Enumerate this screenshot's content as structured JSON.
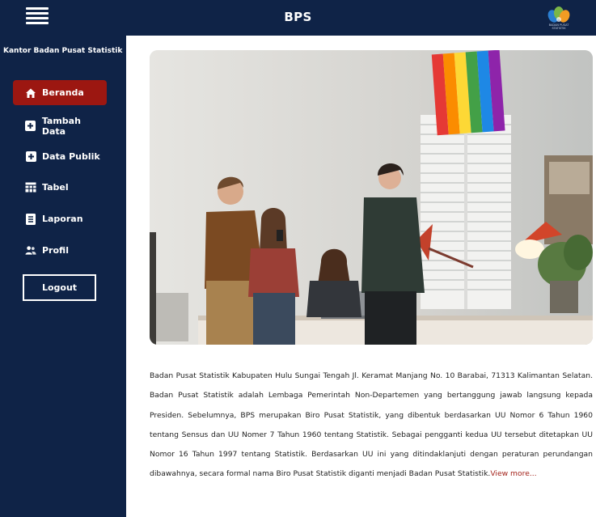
{
  "header": {
    "title": "BPS",
    "logo_text": "BADAN PUSAT STATISTIK"
  },
  "sidebar": {
    "brand": "Kantor Badan Pusat Statistik",
    "items": [
      {
        "label": "Beranda",
        "icon": "home-icon",
        "active": true
      },
      {
        "label": "Tambah Data",
        "icon": "plus-square-icon",
        "active": false
      },
      {
        "label": "Data Publik",
        "icon": "plus-square-icon",
        "active": false
      },
      {
        "label": "Tabel",
        "icon": "table-icon",
        "active": false
      },
      {
        "label": "Laporan",
        "icon": "report-icon",
        "active": false
      },
      {
        "label": "Profil",
        "icon": "users-icon",
        "active": false
      }
    ],
    "logout_label": "Logout"
  },
  "main": {
    "description": "Badan Pusat Statistik Kabupaten Hulu Sungai Tengah Jl. Keramat Manjang No. 10 Barabai, 71313 Kalimantan Selatan. Badan Pusat Statistik adalah Lembaga Pemerintah Non-Departemen yang bertanggung jawab langsung kepada Presiden. Sebelumnya, BPS merupakan Biro Pusat Statistik, yang dibentuk berdasarkan UU Nomor 6 Tahun 1960 tentang Sensus dan UU Nomer 7 Tahun 1960 tentang Statistik. Sebagai pengganti kedua UU tersebut ditetapkan UU Nomor 16 Tahun 1997 tentang Statistik. Berdasarkan UU ini yang ditindaklanjuti dengan peraturan perundangan dibawahnya, secara formal nama Biro Pusat Statistik diganti menjadi Badan Pusat Statistik.",
    "view_more": "View more..."
  },
  "colors": {
    "nav_bg": "#0f2347",
    "active_item": "#9c1711",
    "link": "#a3231b"
  }
}
